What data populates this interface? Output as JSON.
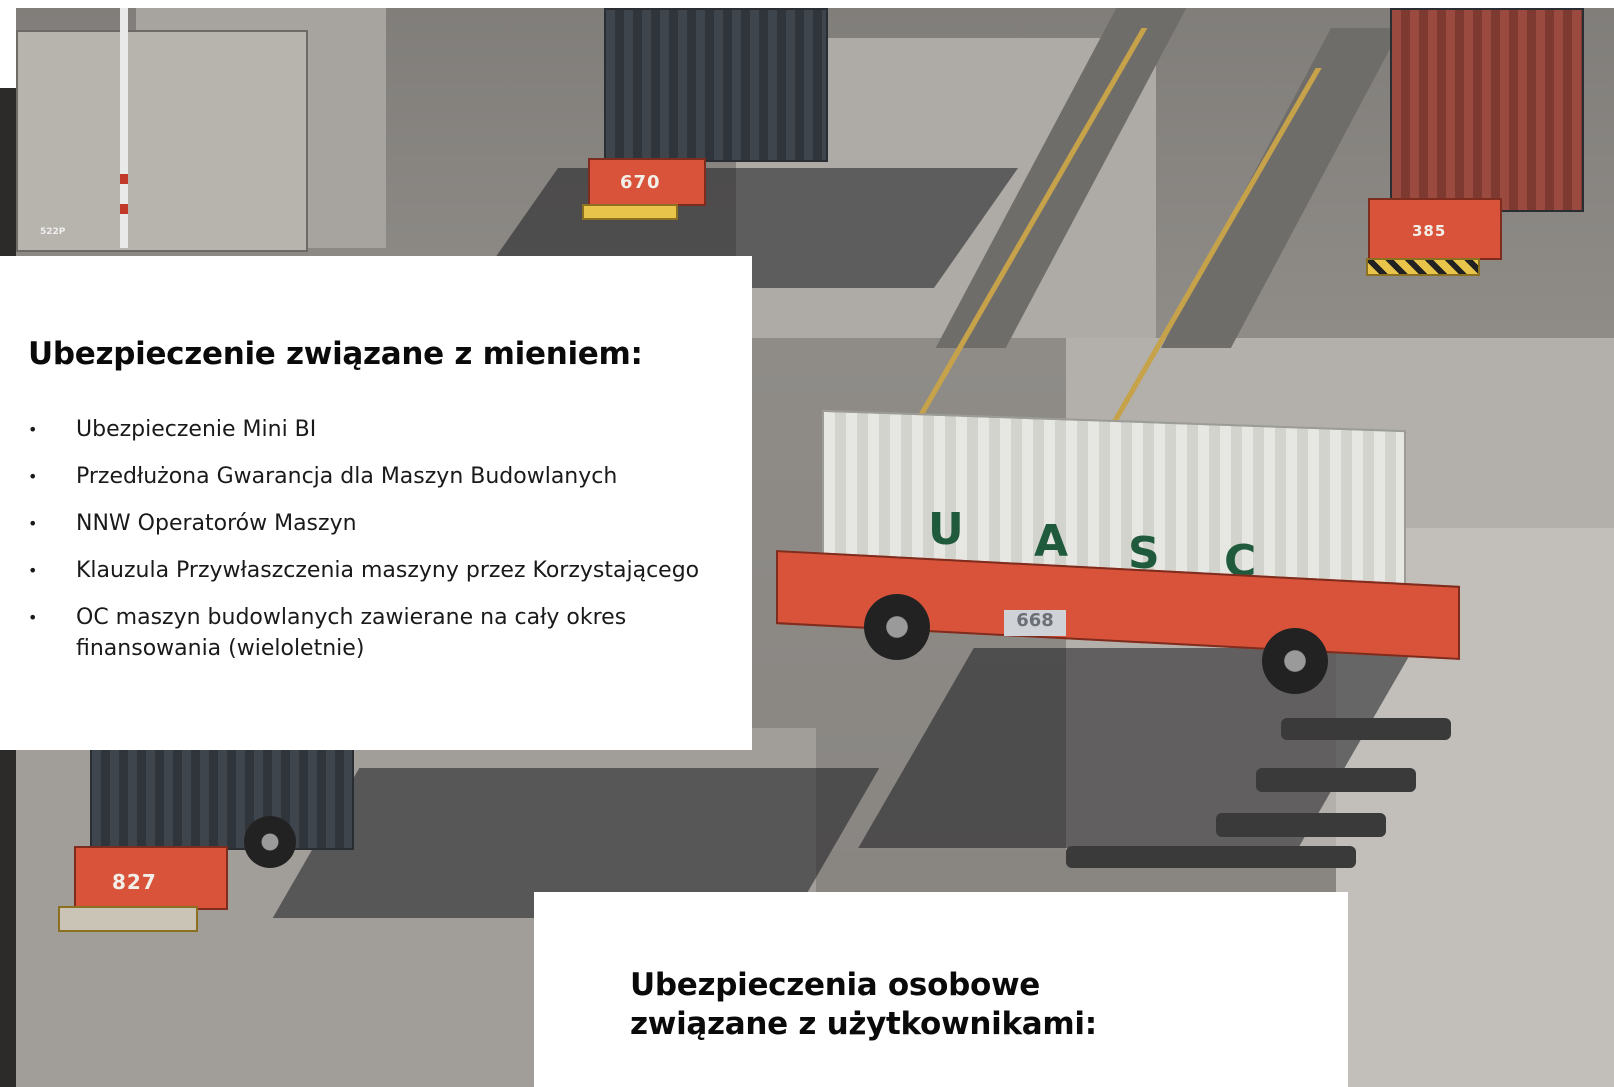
{
  "background": {
    "description_icon": "container-terminal-photo",
    "vehicle_numbers": [
      "670",
      "385",
      "668",
      "827"
    ],
    "container_letters": [
      "U",
      "A",
      "S",
      "C"
    ],
    "building_label": "522P",
    "colors": {
      "asphalt": "#8f8c88",
      "vehicle_orange": "#d9533a",
      "container_green_text": "#1f5a3d"
    }
  },
  "panel_property": {
    "title": "Ubezpieczenie związane z mieniem:",
    "bullet_icon": "bullet-dot-icon",
    "items": [
      {
        "line1": "Ubezpieczenie Mini BI",
        "line2": ""
      },
      {
        "line1": "Przedłużona Gwarancja dla Maszyn Budowlanych",
        "line2": ""
      },
      {
        "line1": "NNW Operatorów Maszyn",
        "line2": ""
      },
      {
        "line1": "Klauzula Przywłaszczenia maszyny przez Korzystającego",
        "line2": ""
      },
      {
        "line1": "OC maszyn budowlanych zawierane na cały okres",
        "line2": "finansowania (wieloletnie)"
      }
    ]
  },
  "panel_personal": {
    "title_line1": "Ubezpieczenia osobowe",
    "title_line2": "związane z użytkownikami:"
  }
}
